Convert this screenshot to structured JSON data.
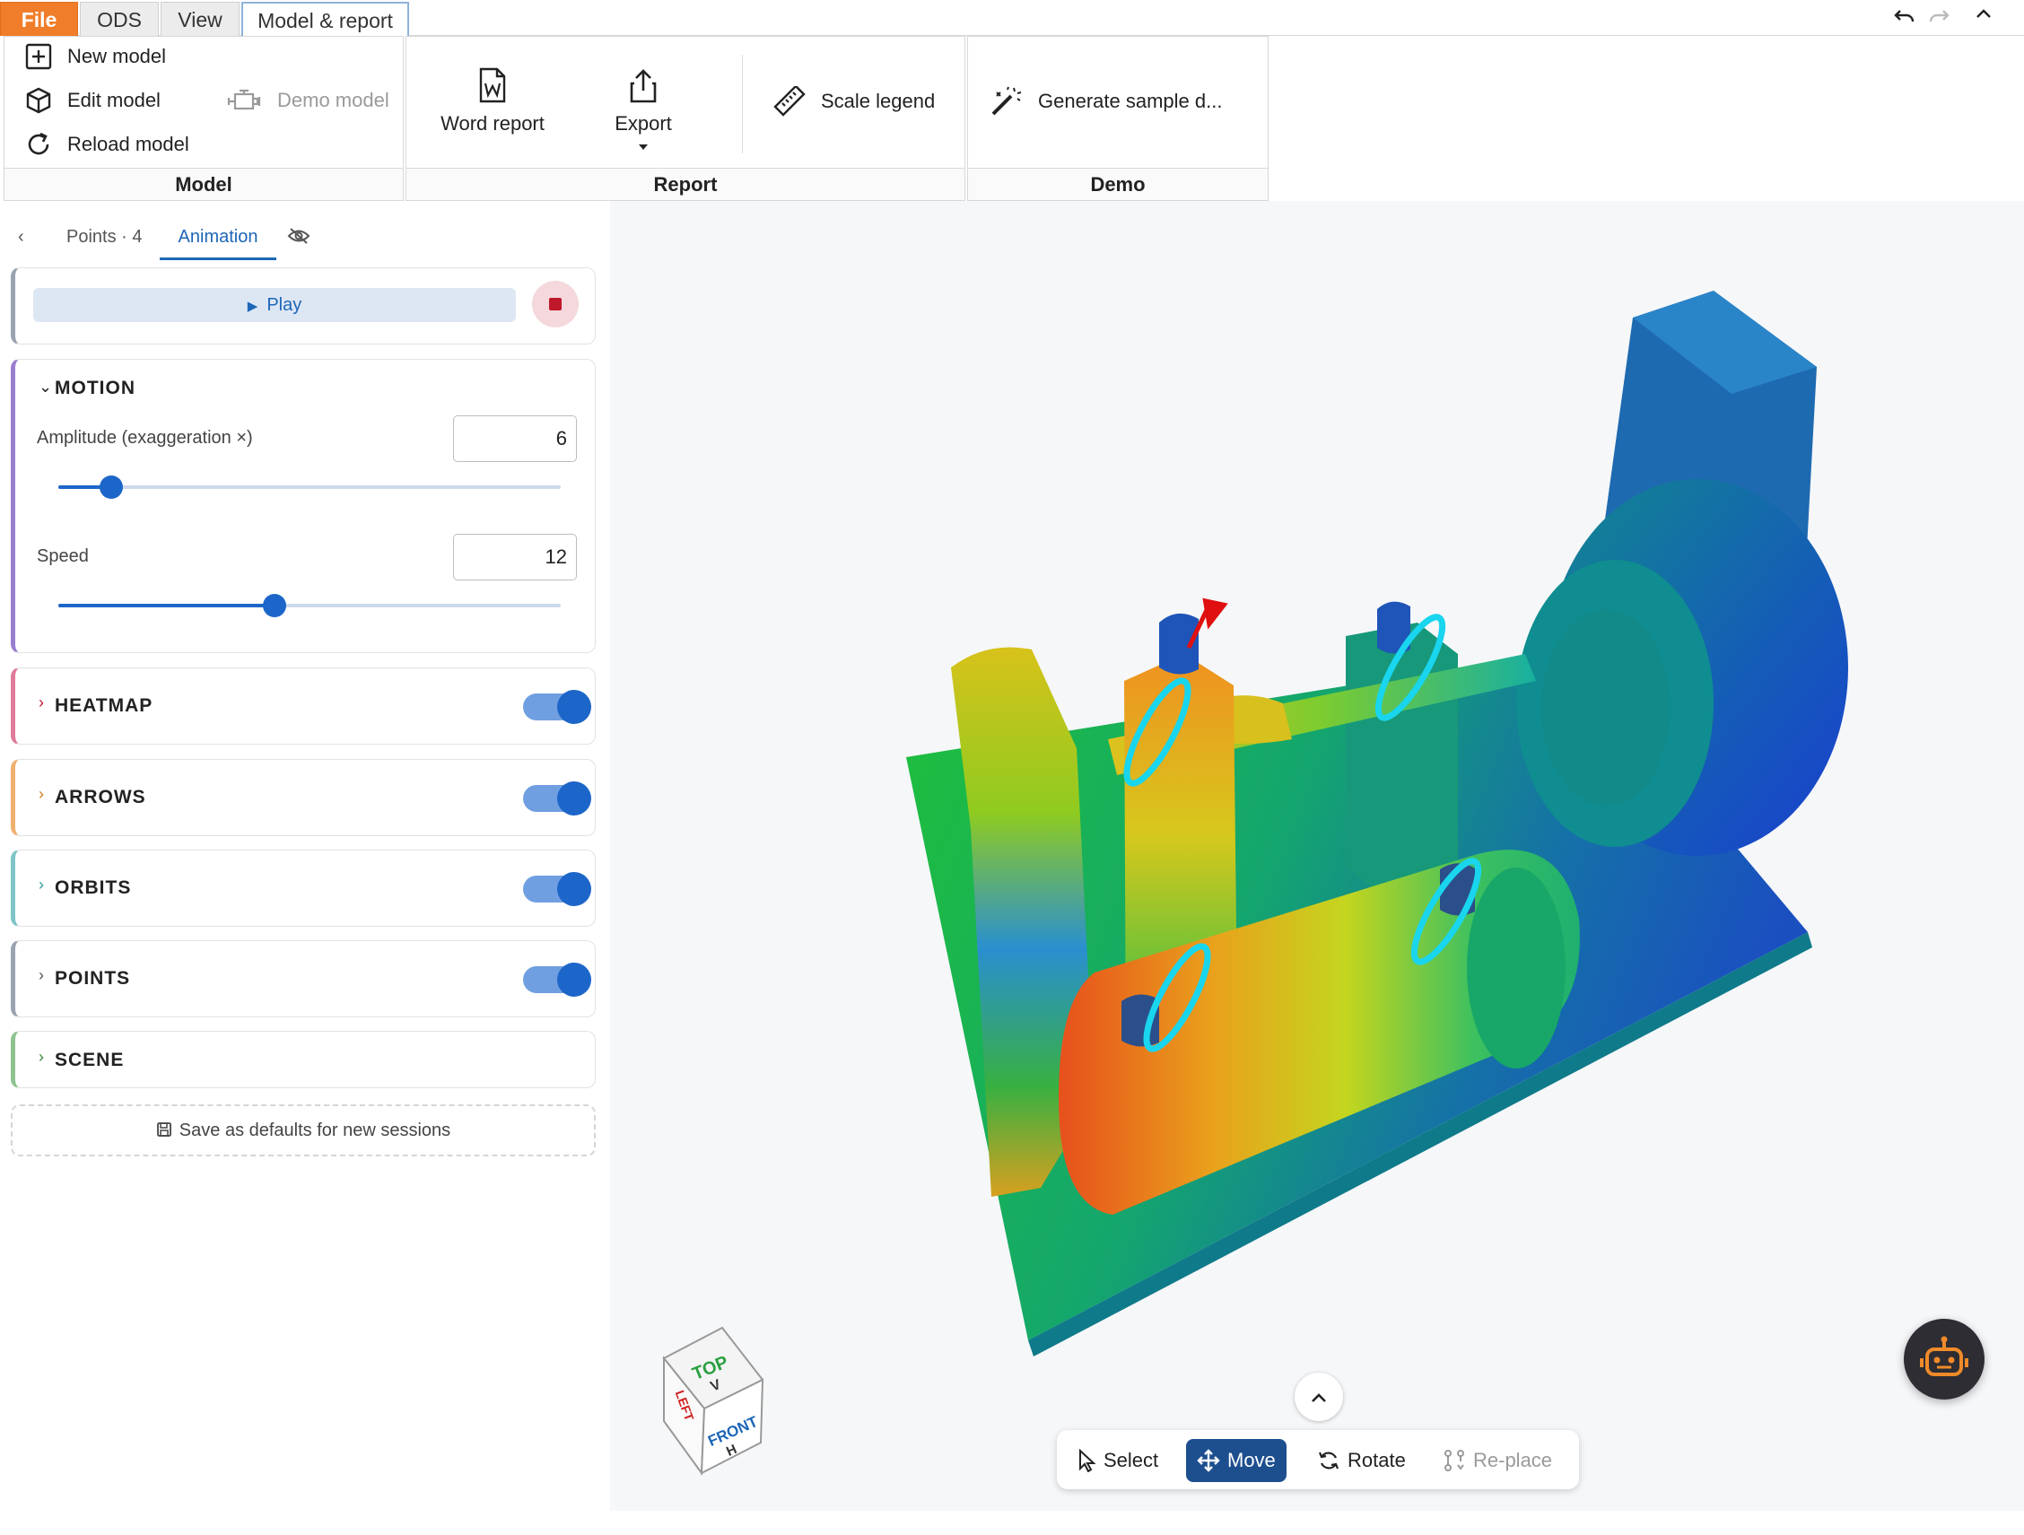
{
  "menu": {
    "tabs": [
      {
        "label": "File"
      },
      {
        "label": "ODS"
      },
      {
        "label": "View"
      },
      {
        "label": "Model & report"
      }
    ]
  },
  "ribbon": {
    "model": {
      "new_model": "New model",
      "edit_model": "Edit model",
      "demo_model": "Demo model",
      "reload_model": "Reload model",
      "group_label": "Model"
    },
    "report": {
      "word_report": "Word report",
      "export": "Export",
      "scale_legend": "Scale legend",
      "group_label": "Report"
    },
    "demo": {
      "generate_sample": "Generate sample d...",
      "group_label": "Demo"
    }
  },
  "panel": {
    "subtabs": [
      {
        "label": "Points · 4"
      },
      {
        "label": "Animation"
      }
    ],
    "play_label": "Play",
    "motion": {
      "title": "MOTION",
      "amplitude_label": "Amplitude (exaggeration ×)",
      "amplitude_value": "6",
      "amplitude_fraction": 0.105,
      "speed_label": "Speed",
      "speed_value": "12",
      "speed_fraction": 0.43
    },
    "sections": [
      {
        "title": "HEATMAP",
        "enabled": true,
        "color": "#e07b9a"
      },
      {
        "title": "ARROWS",
        "enabled": true,
        "color": "#f0b070"
      },
      {
        "title": "ORBITS",
        "enabled": true,
        "color": "#7ec4c8"
      },
      {
        "title": "POINTS",
        "enabled": true,
        "color": "#9aa3b0"
      },
      {
        "title": "SCENE",
        "color": "#8fc28f"
      }
    ],
    "save_defaults": "Save as defaults for new sessions"
  },
  "viewcube": {
    "top": "TOP",
    "top_sub": "V",
    "front": "FRONT",
    "front_sub": "H",
    "left": "LEFT"
  },
  "toolbar": {
    "select": "Select",
    "move": "Move",
    "rotate": "Rotate",
    "replace": "Re-place"
  }
}
